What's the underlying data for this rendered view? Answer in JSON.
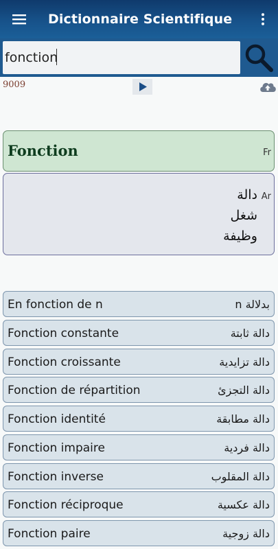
{
  "app": {
    "title": "Dictionnaire Scientifique",
    "accent": "#1b5f98",
    "icons": {
      "menu": "hamburger-menu-icon",
      "more": "more-vert-icon",
      "search": "search-icon",
      "play": "play-icon",
      "cloud": "cloud-upload-icon"
    }
  },
  "search": {
    "value": "fonction"
  },
  "result": {
    "count": "9009",
    "word_fr": "Fonction",
    "fr_tag": "Fr",
    "ar_tag": "Ar",
    "translations_ar": [
      "دالة",
      "شغل",
      "وظيفة"
    ]
  },
  "list": {
    "items": [
      {
        "fr": "En fonction de n",
        "ar": "بدلالة n"
      },
      {
        "fr": "Fonction constante",
        "ar": "دالة ثابتة"
      },
      {
        "fr": "Fonction croissante",
        "ar": "دالة تزايدية"
      },
      {
        "fr": "Fonction de répartition",
        "ar": "دالة التجزئ"
      },
      {
        "fr": "Fonction identité",
        "ar": "دالة مطابقة"
      },
      {
        "fr": "Fonction impaire",
        "ar": "دالة فردية"
      },
      {
        "fr": "Fonction inverse",
        "ar": "دالة المقلوب"
      },
      {
        "fr": "Fonction réciproque",
        "ar": "دالة عكسية"
      },
      {
        "fr": "Fonction paire",
        "ar": "دالة زوجية"
      }
    ]
  }
}
